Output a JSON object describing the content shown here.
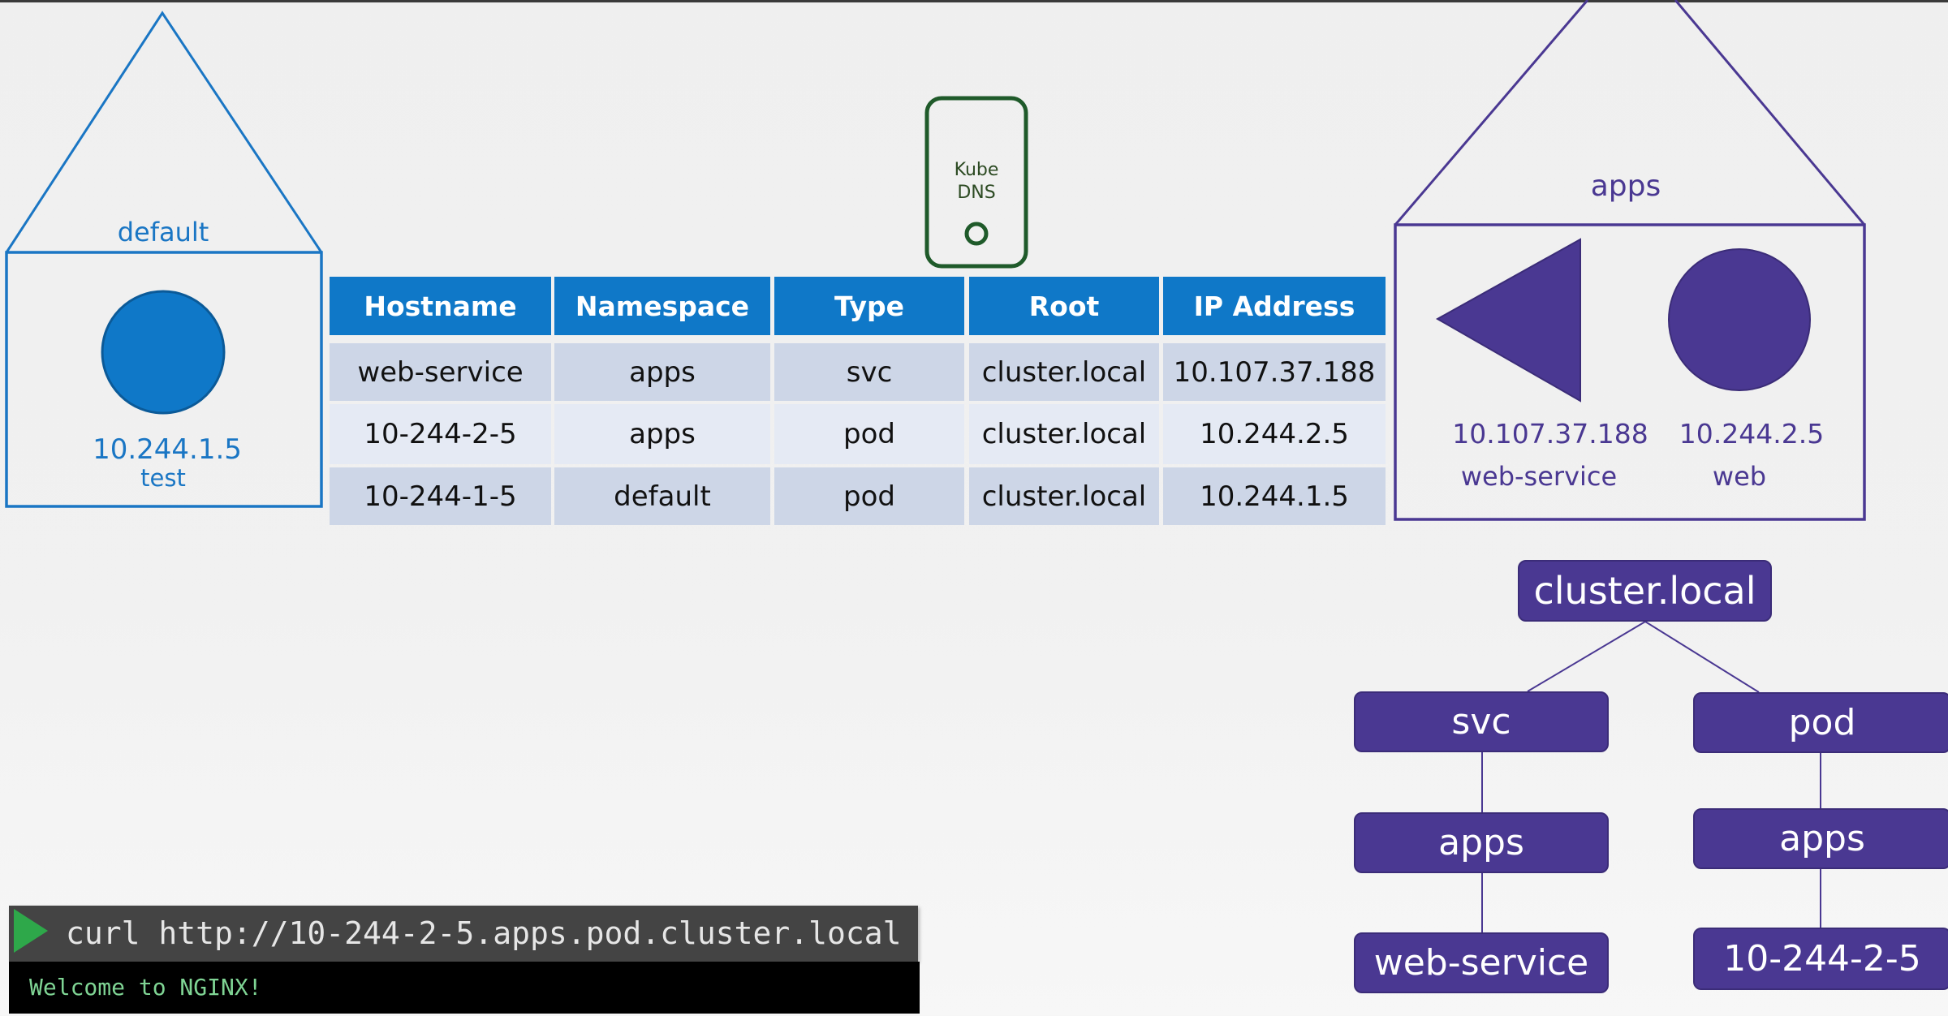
{
  "colors": {
    "default_ns": "#1a76c4",
    "apps_ns": "#4a3892",
    "kube_dns": "#1f5a2a",
    "table_header": "#0f78c8",
    "row_dark": "#cdd6e7",
    "row_light": "#e5eaf4",
    "terminal_prompt": "#2ea84a",
    "terminal_output": "#7fd494"
  },
  "default_namespace": {
    "label": "default",
    "pod": {
      "ip": "10.244.1.5",
      "name": "test",
      "icon": "pod-circle-icon"
    }
  },
  "kube_dns": {
    "line1": "Kube",
    "line2": "DNS",
    "icon": "kube-dns-pod-icon"
  },
  "dns_table": {
    "headers": [
      "Hostname",
      "Namespace",
      "Type",
      "Root",
      "IP Address"
    ],
    "rows": [
      [
        "web-service",
        "apps",
        "svc",
        "cluster.local",
        "10.107.37.188"
      ],
      [
        "10-244-2-5",
        "apps",
        "pod",
        "cluster.local",
        "10.244.2.5"
      ],
      [
        "10-244-1-5",
        "default",
        "pod",
        "cluster.local",
        "10.244.1.5"
      ]
    ]
  },
  "apps_namespace": {
    "label": "apps",
    "service": {
      "ip": "10.107.37.188",
      "name": "web-service",
      "icon": "service-triangle-icon"
    },
    "pod": {
      "ip": "10.244.2.5",
      "name": "web",
      "icon": "pod-circle-icon"
    }
  },
  "dns_tree": {
    "root": "cluster.local",
    "branches": [
      {
        "type": "svc",
        "namespace": "apps",
        "leaf": "web-service"
      },
      {
        "type": "pod",
        "namespace": "apps",
        "leaf": "10-244-2-5"
      }
    ]
  },
  "terminal": {
    "command": "curl http://10-244-2-5.apps.pod.cluster.local",
    "output": "Welcome to NGINX!",
    "prompt_icon": "play-arrow-icon"
  }
}
